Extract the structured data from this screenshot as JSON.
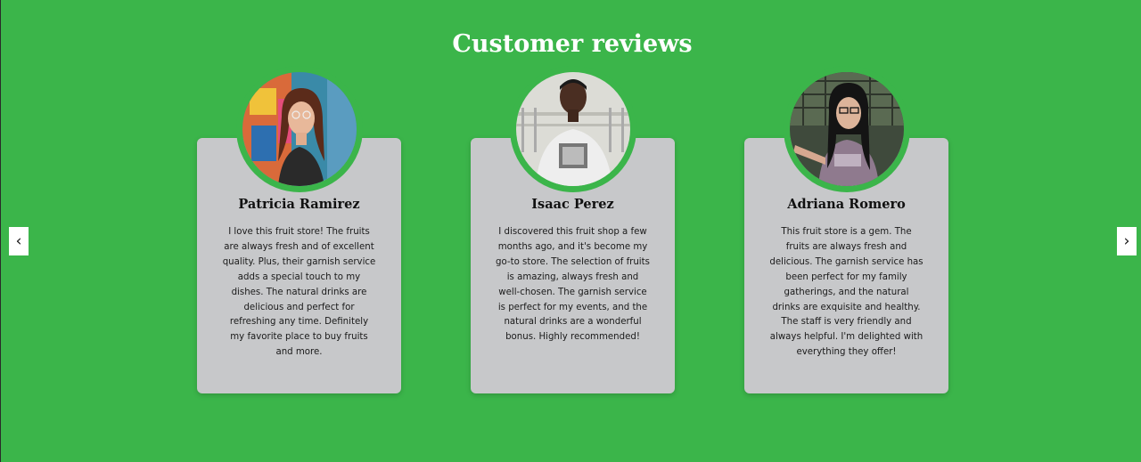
{
  "section": {
    "title": "Customer reviews"
  },
  "carousel": {
    "prev_label": "‹",
    "next_label": "›"
  },
  "reviews": [
    {
      "name": "Patricia Ramirez",
      "text": "I love this fruit store! The fruits are always fresh and of excellent quality. Plus, their garnish service adds a special touch to my dishes. The natural drinks are delicious and perfect for refreshing any time. Definitely my favorite place to buy fruits and more."
    },
    {
      "name": "Isaac Perez",
      "text": "I discovered this fruit shop a few months ago, and it's become my go-to store. The selection of fruits is amazing, always fresh and well-chosen. The garnish service is perfect for my events, and the natural drinks are a wonderful bonus. Highly recommended!"
    },
    {
      "name": "Adriana Romero",
      "text": "This fruit store is a gem. The fruits are always fresh and delicious. The garnish service has been perfect for my family gatherings, and the natural drinks are exquisite and healthy. The staff is very friendly and always helpful. I'm delighted with everything they offer!"
    }
  ],
  "colors": {
    "background": "#3bb54a",
    "card": "#c7c8ca",
    "title": "#ffffff"
  }
}
